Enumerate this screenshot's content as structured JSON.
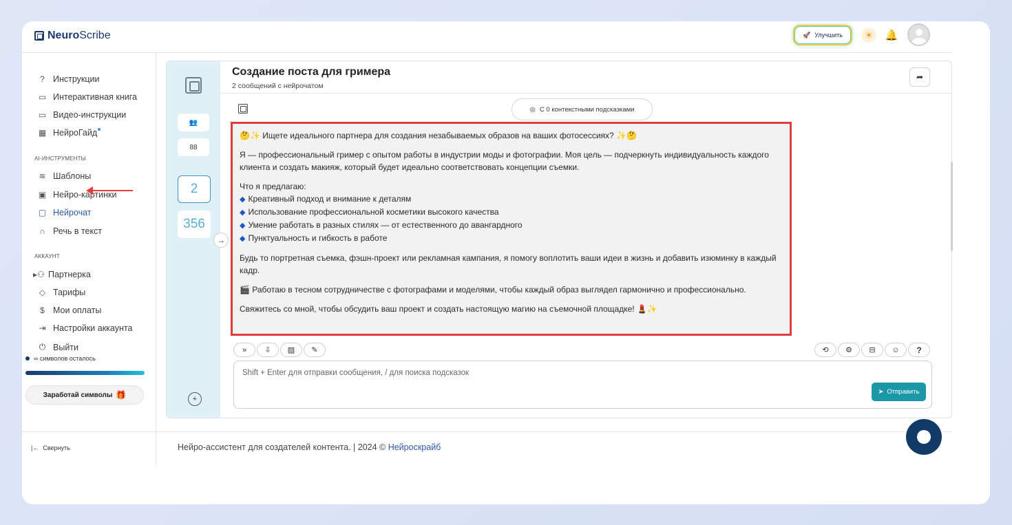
{
  "header": {
    "logo_bold": "Neuro",
    "logo_rest": "Scribe",
    "upgrade_label": "Улучшить"
  },
  "sidebar": {
    "items_top": [
      {
        "label": "Инструкции",
        "icon": "question-circle-icon"
      },
      {
        "label": "Интерактивная книга",
        "icon": "book-icon"
      },
      {
        "label": "Видео-инструкции",
        "icon": "video-icon"
      },
      {
        "label": "НейроГайд",
        "icon": "guide-icon"
      }
    ],
    "section_ai": "AI-ИНСТРУМЕНТЫ",
    "items_ai": [
      {
        "label": "Шаблоны",
        "icon": "layers-icon"
      },
      {
        "label": "Нейро-картинки",
        "icon": "image-icon"
      },
      {
        "label": "Нейрочат",
        "icon": "chat-icon"
      },
      {
        "label": "Речь в текст",
        "icon": "headphones-icon"
      }
    ],
    "section_account": "АККАУНТ",
    "items_account": [
      {
        "label": "Партнерка",
        "icon": "users-icon"
      },
      {
        "label": "Тарифы",
        "icon": "tag-icon"
      },
      {
        "label": "Мои оплаты",
        "icon": "dollar-icon"
      },
      {
        "label": "Настройки аккаунта",
        "icon": "settings-arrow-icon"
      },
      {
        "label": "Выйти",
        "icon": "power-icon"
      }
    ],
    "symbols_left": "∞ символов осталось",
    "symbols_progress": 1.0,
    "earn_label": "Заработай символы",
    "collapse_label": "Свернуть"
  },
  "rail": {
    "count_active": "2",
    "count_other": "356"
  },
  "chat": {
    "title": "Создание поста для гримера",
    "subtitle": "2 сообщений с нейрочатом",
    "context_label": "С 0 контекстными подсказками",
    "message": {
      "line1": "🤔✨ Ищете идеального партнера для создания незабываемых образов на ваших фотосессиях? ✨🤔",
      "para2": "Я — профессиональный гример с опытом работы в индустрии моды и фотографии. Моя цель — подчеркнуть индивидуальность каждого клиента и создать макияж, который будет идеально соответствовать концепции съемки.",
      "offer_title": "Что я предлагаю:",
      "offers": [
        "Креативный подход и внимание к деталям",
        "Использование профессиональной косметики высокого качества",
        "Умение работать в разных стилях — от естественного до авангардного",
        "Пунктуальность и гибкость в работе"
      ],
      "para3": "Будь то портретная съемка, фэшн-проект или рекламная кампания, я помогу воплотить ваши идеи в жизнь и добавить изюминку в каждый кадр.",
      "para4": "🎬 Работаю в тесном сотрудничестве с фотографами и моделями, чтобы каждый образ выглядел гармонично и профессионально.",
      "para5": "Свяжитесь со мной, чтобы обсудить ваш проект и создать настоящую магию на съемочной площадке! 💄✨"
    },
    "input_placeholder": "Shift + Enter для отправки сообщения, / для поиска подсказок",
    "send_label": "Отправить",
    "help_label": "?"
  },
  "footer": {
    "text": "Нейро-ассистент для создателей контента.  | 2024 © ",
    "link": "Нейроскрайб"
  }
}
